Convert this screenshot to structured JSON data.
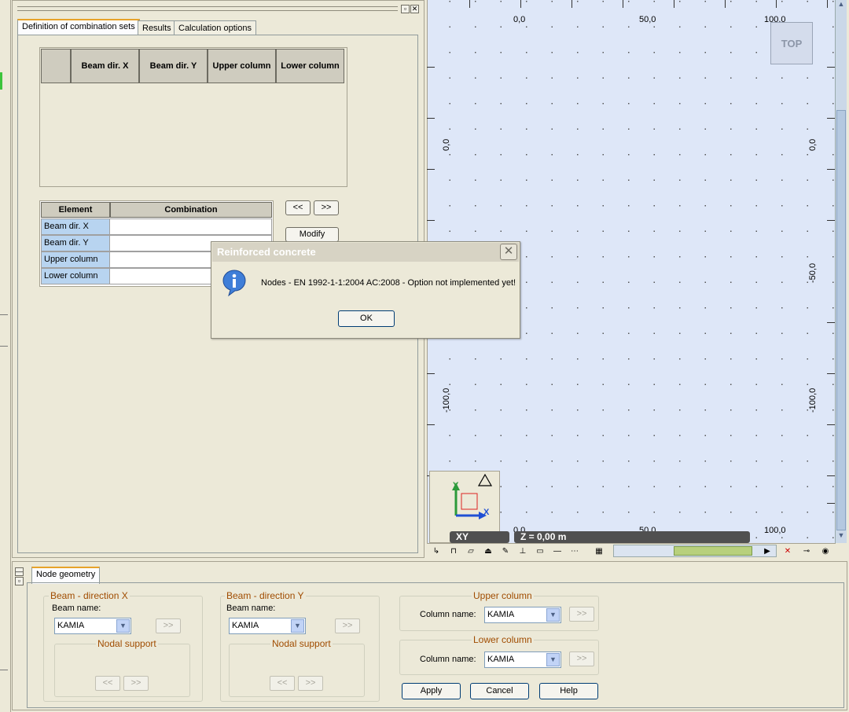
{
  "left_panel": {
    "tabs": [
      "Definition of combination sets",
      "Results",
      "Calculation options"
    ],
    "grid1": {
      "columns": [
        "Beam dir. X",
        "Beam dir. Y",
        "Upper column",
        "Lower column"
      ]
    },
    "grid2": {
      "columns": [
        "Element",
        "Combination"
      ],
      "rows": [
        "Beam dir. X",
        "Beam dir. Y",
        "Upper column",
        "Lower column"
      ]
    },
    "buttons": {
      "prev": "<<",
      "next": ">>",
      "modify": "Modify"
    }
  },
  "viewport": {
    "top_labels": [
      "0,0",
      "50,0",
      "100,0"
    ],
    "bottom_labels": [
      "0,0",
      "50,0",
      "100,0"
    ],
    "left_labels": [
      "0,0",
      "-100,0"
    ],
    "right_labels": [
      "0,0",
      "-50,0",
      "-100,0"
    ],
    "view_cube": "TOP",
    "plane": "XY",
    "z_level": "Z = 0,00 m",
    "axis_y": "Y",
    "axis_x": "X"
  },
  "bottom_panel": {
    "tab": "Node geometry",
    "beam_x": {
      "title": "Beam - direction X",
      "beam_name_label": "Beam name:",
      "beam_name_value": "KAMIA",
      "forward": ">>",
      "nodal_support": "Nodal support",
      "prev": "<<",
      "next": ">>"
    },
    "beam_y": {
      "title": "Beam - direction Y",
      "beam_name_label": "Beam name:",
      "beam_name_value": "KAMIA",
      "forward": ">>",
      "nodal_support": "Nodal support",
      "prev": "<<",
      "next": ">>"
    },
    "upper_column": {
      "title": "Upper column",
      "column_name_label": "Column name:",
      "column_name_value": "KAMIA",
      "forward": ">>"
    },
    "lower_column": {
      "title": "Lower column",
      "column_name_label": "Column name:",
      "column_name_value": "KAMIA",
      "forward": ">>"
    },
    "buttons": {
      "apply": "Apply",
      "cancel": "Cancel",
      "help": "Help"
    }
  },
  "dialog": {
    "title": "Reinforced concrete",
    "message": "Nodes - EN 1992-1-1:2004 AC:2008 - Option not implemented yet!",
    "ok": "OK"
  },
  "colors": {
    "window_bg": "#ece9d8",
    "viewport_bg": "#dee7f8",
    "group_title": "#a04c00",
    "row_header_blue": "#b8d4f0",
    "axis_x": "#1f4fd4",
    "axis_y": "#2c9a3a"
  }
}
